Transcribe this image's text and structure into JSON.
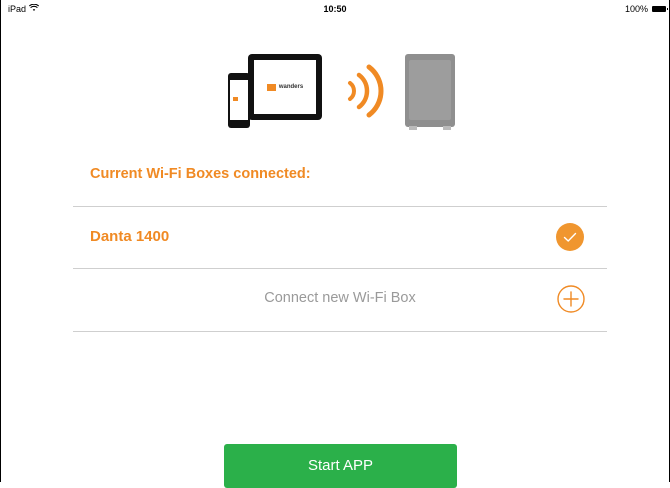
{
  "status_bar": {
    "device": "iPad",
    "time": "10:50",
    "battery": "100%"
  },
  "hero": {
    "brand": "wanders"
  },
  "section": {
    "title": "Current Wi-Fi Boxes connected:"
  },
  "boxes": [
    {
      "name": "Danta 1400",
      "status": "connected"
    }
  ],
  "actions": {
    "connect_new": "Connect new Wi-Fi Box",
    "start": "Start APP"
  },
  "colors": {
    "accent": "#f08a24",
    "primary_button": "#2bb04a",
    "muted_text": "#9a9a9a",
    "divider": "#cfcfcf"
  }
}
